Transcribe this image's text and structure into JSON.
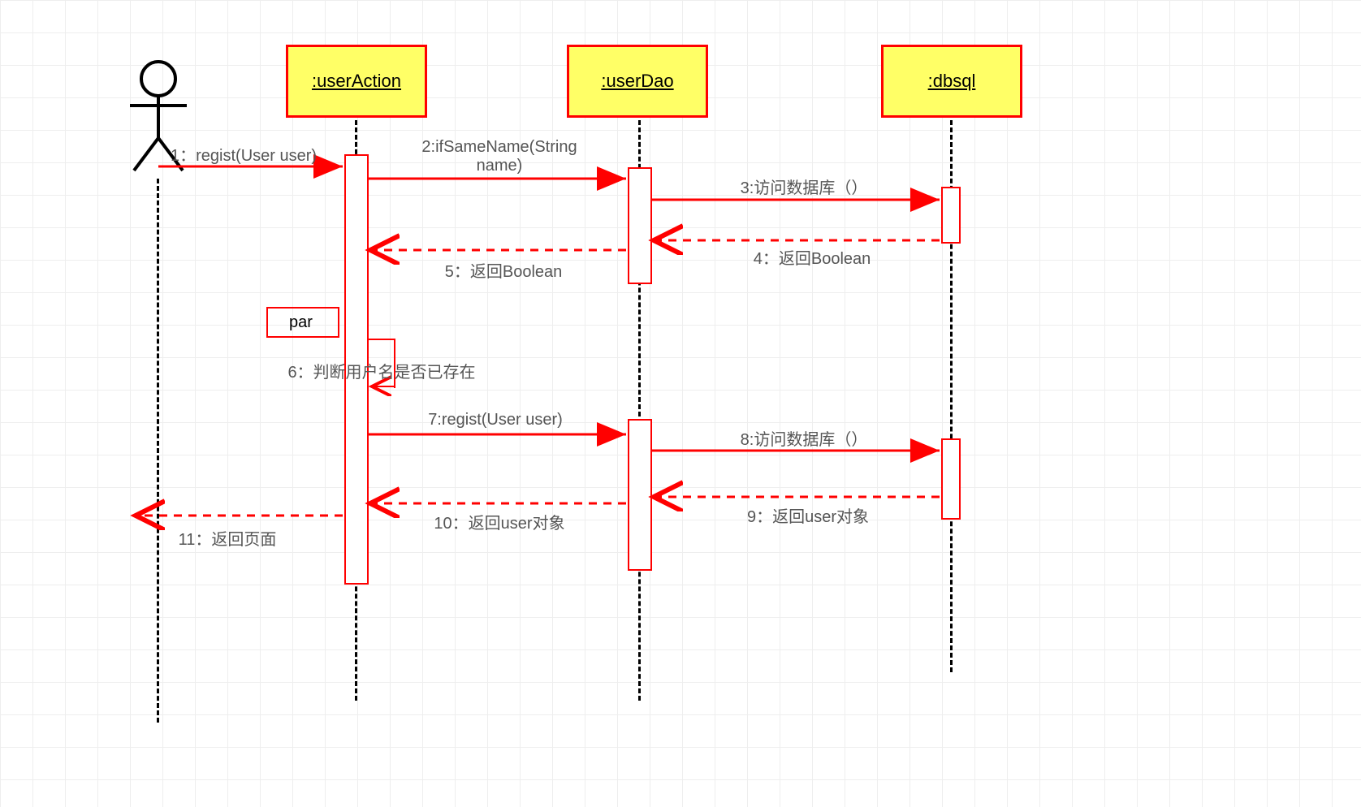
{
  "participants": {
    "actor": {
      "label": ""
    },
    "userAction": {
      "label": ":userAction"
    },
    "userDao": {
      "label": ":userDao"
    },
    "dbsql": {
      "label": ":dbsql"
    }
  },
  "fragment": {
    "operator": "par"
  },
  "messages": {
    "m1": "1：regist(User user)",
    "m2": "2:ifSameName(String\nname)",
    "m3": "3:访问数据库（）",
    "m4": "4：返回Boolean",
    "m5": "5：返回Boolean",
    "m6": "6：判断用户名是否已存在",
    "m7": "7:regist(User user)",
    "m8": "8:访问数据库（）",
    "m9": "9：返回user对象",
    "m10": "10：返回user对象",
    "m11": "11：返回页面"
  },
  "style": {
    "participantFill": "#ffff66",
    "lineColor": "#ff0000",
    "textColor": "#555555"
  }
}
